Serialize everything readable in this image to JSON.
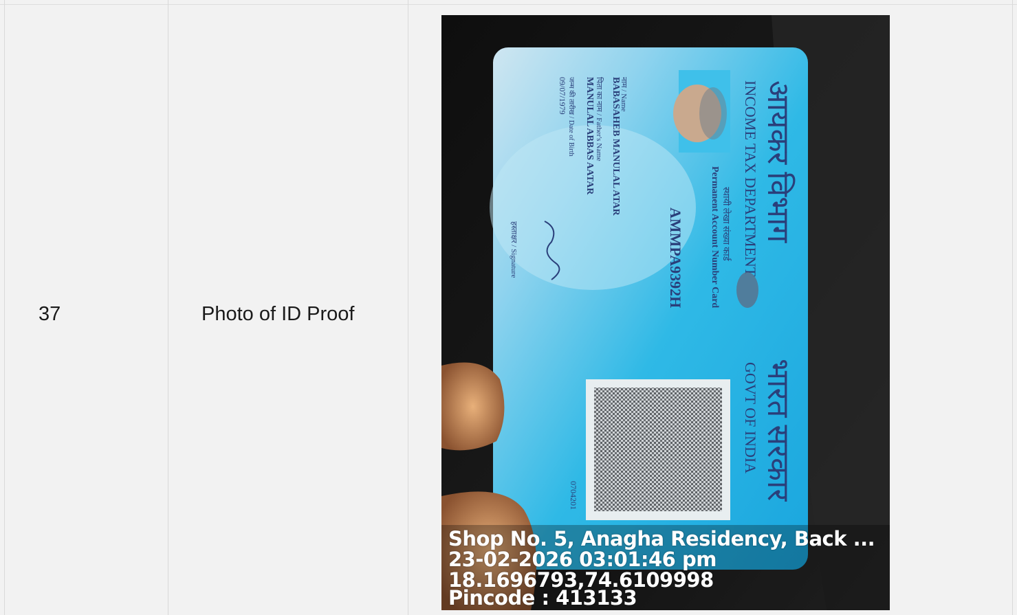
{
  "row": {
    "serial": "37",
    "field_label": "Photo of ID Proof"
  },
  "photo": {
    "card": {
      "header_hindi_left": "आयकर विभाग",
      "header_hindi_right": "भारत सरकार",
      "department": "INCOME TAX DEPARTMENT",
      "govt": "GOVT OF INDIA",
      "card_title_hindi": "स्थायी लेखा संख्या कार्ड",
      "card_title": "Permanent Account Number Card",
      "pan_number": "AMMPA9392H",
      "name_label": "नाम / Name",
      "name": "BABASAHEB MANULAL ATAR",
      "father_label": "पिता का नाम / Father's Name",
      "father_name": "MANULAL ABBAS AATAR",
      "dob_label": "जन्म की तारीख / Date of Birth",
      "dob": "09/07/1979",
      "signature_label": "हस्ताक्षर / Signature",
      "serial_code": "0704201"
    },
    "geotag": {
      "address": "Shop No. 5, Anagha Residency, Back ...",
      "datetime": "23-02-2026 03:01:46 pm",
      "coordinates": "18.1696793,74.6109998",
      "pincode": "Pincode : 413133"
    }
  }
}
